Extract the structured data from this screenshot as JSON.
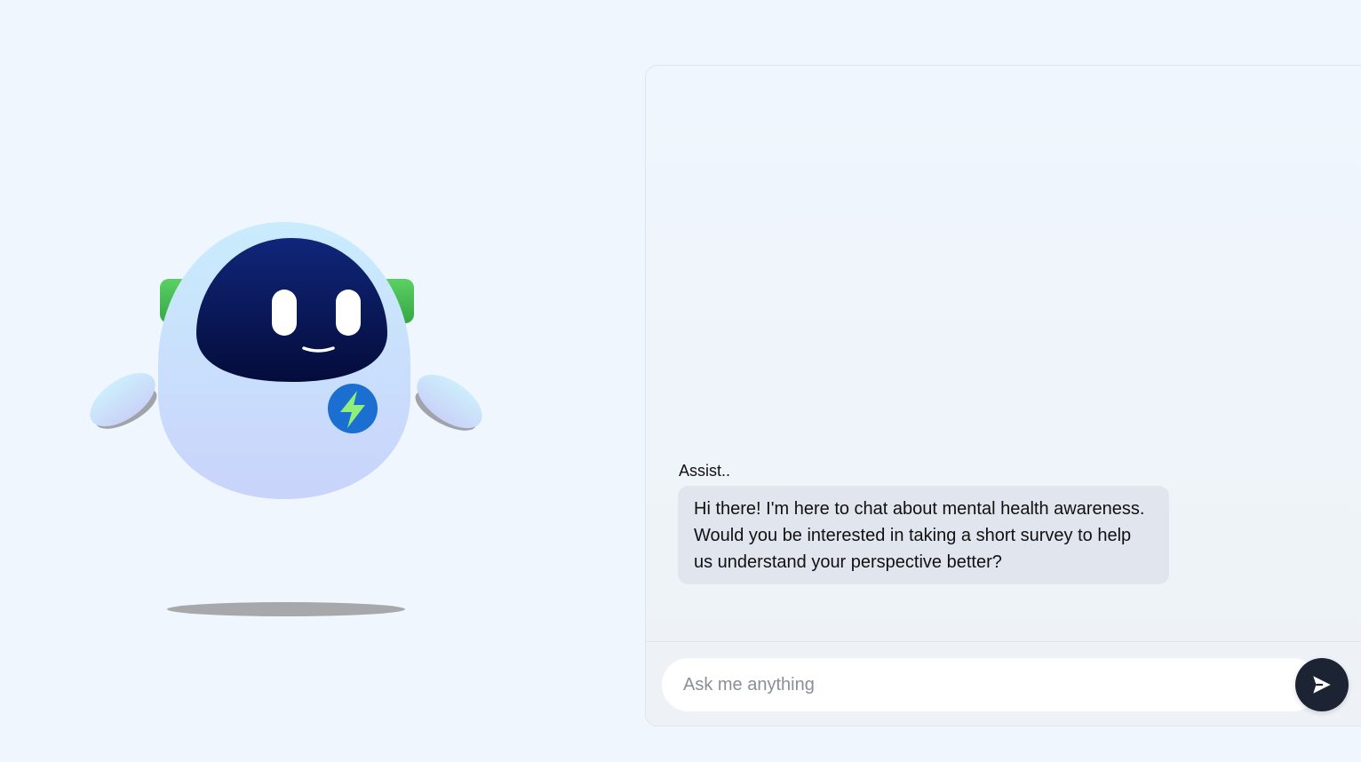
{
  "mascot": {
    "icon": "robot-mascot",
    "badge_icon": "lightning-bolt-icon"
  },
  "chat": {
    "messages": [
      {
        "sender": "Assist..",
        "text": "Hi there! I'm here to chat about mental health awareness. Would you be interested in taking a short survey to help us understand your perspective better?"
      }
    ],
    "input": {
      "value": "",
      "placeholder": "Ask me anything"
    },
    "send_icon": "send-arrow-icon"
  },
  "colors": {
    "background": "#eff6fd",
    "bubble": "#e0e5ee",
    "send_button": "#1c2433",
    "robot_face": "#0a1f66",
    "robot_ears": "#4cc35a",
    "badge": "#1b6fd1",
    "bolt": "#8ef07a"
  }
}
